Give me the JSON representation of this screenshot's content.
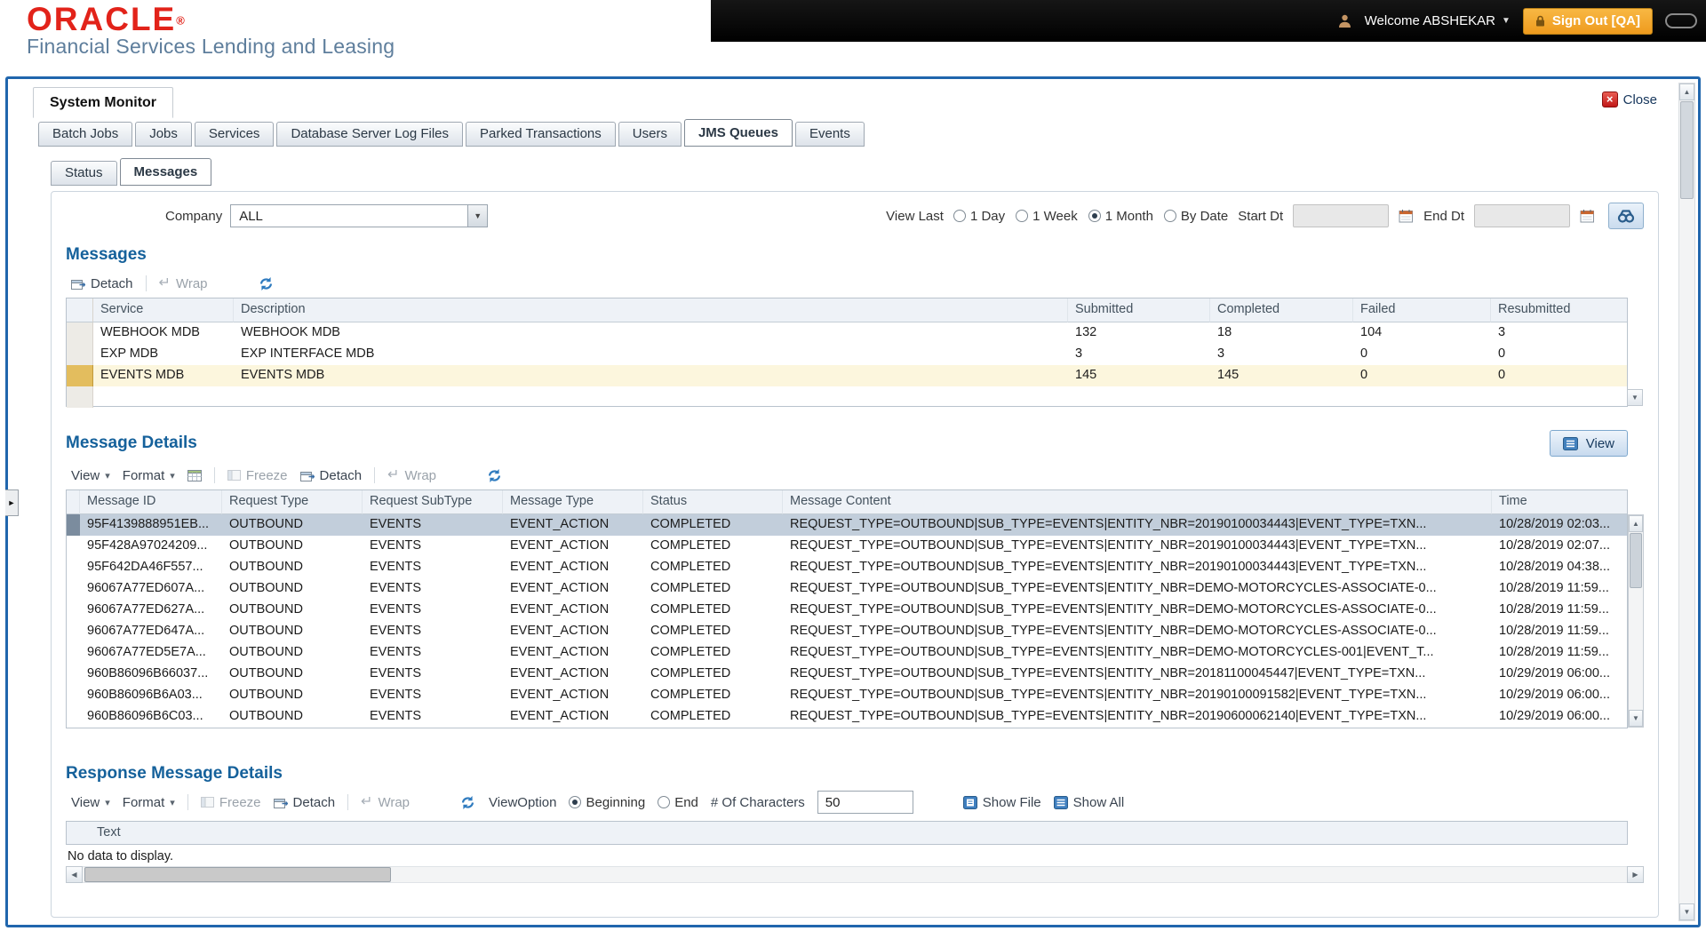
{
  "header": {
    "brand": "ORACLE",
    "registered": "®",
    "subtitle": "Financial Services Lending and Leasing",
    "welcome": "Welcome ABSHEKAR",
    "sign_out": "Sign Out [QA]"
  },
  "window": {
    "title": "System Monitor",
    "close": "Close"
  },
  "tabs": [
    {
      "label": "Batch Jobs"
    },
    {
      "label": "Jobs"
    },
    {
      "label": "Services"
    },
    {
      "label": "Database Server Log Files"
    },
    {
      "label": "Parked Transactions"
    },
    {
      "label": "Users"
    },
    {
      "label": "JMS Queues",
      "active": true
    },
    {
      "label": "Events"
    }
  ],
  "subtabs": [
    {
      "label": "Status"
    },
    {
      "label": "Messages",
      "active": true
    }
  ],
  "filters": {
    "company_label": "Company",
    "company_value": "ALL",
    "view_last_label": "View Last",
    "view_last_options": [
      {
        "label": "1 Day"
      },
      {
        "label": "1 Week"
      },
      {
        "label": "1 Month",
        "selected": true
      },
      {
        "label": "By Date"
      }
    ],
    "start_dt_label": "Start Dt",
    "start_dt_value": "",
    "end_dt_label": "End Dt",
    "end_dt_value": ""
  },
  "messages": {
    "title": "Messages",
    "toolbar": {
      "detach": "Detach",
      "wrap": "Wrap"
    },
    "columns": [
      "Service",
      "Description",
      "Submitted",
      "Completed",
      "Failed",
      "Resubmitted"
    ],
    "rows": [
      {
        "service": "WEBHOOK MDB",
        "description": "WEBHOOK MDB",
        "submitted": "132",
        "completed": "18",
        "failed": "104",
        "resubmitted": "3"
      },
      {
        "service": "EXP MDB",
        "description": "EXP INTERFACE MDB",
        "submitted": "3",
        "completed": "3",
        "failed": "0",
        "resubmitted": "0"
      },
      {
        "service": "EVENTS MDB",
        "description": "EVENTS MDB",
        "submitted": "145",
        "completed": "145",
        "failed": "0",
        "resubmitted": "0",
        "highlight": true
      }
    ]
  },
  "message_details": {
    "title": "Message Details",
    "view_button": "View",
    "toolbar": {
      "view": "View",
      "format": "Format",
      "freeze": "Freeze",
      "detach": "Detach",
      "wrap": "Wrap"
    },
    "columns": [
      "Message ID",
      "Request Type",
      "Request SubType",
      "Message Type",
      "Status",
      "Message Content",
      "Time"
    ],
    "rows": [
      {
        "id": "95F4139888951EB...",
        "request_type": "OUTBOUND",
        "sub_type": "EVENTS",
        "message_type": "EVENT_ACTION",
        "status": "COMPLETED",
        "content": "REQUEST_TYPE=OUTBOUND|SUB_TYPE=EVENTS|ENTITY_NBR=20190100034443|EVENT_TYPE=TXN...",
        "time": "10/28/2019 02:03...",
        "selected": true
      },
      {
        "id": "95F428A97024209...",
        "request_type": "OUTBOUND",
        "sub_type": "EVENTS",
        "message_type": "EVENT_ACTION",
        "status": "COMPLETED",
        "content": "REQUEST_TYPE=OUTBOUND|SUB_TYPE=EVENTS|ENTITY_NBR=20190100034443|EVENT_TYPE=TXN...",
        "time": "10/28/2019 02:07..."
      },
      {
        "id": "95F642DA46F557...",
        "request_type": "OUTBOUND",
        "sub_type": "EVENTS",
        "message_type": "EVENT_ACTION",
        "status": "COMPLETED",
        "content": "REQUEST_TYPE=OUTBOUND|SUB_TYPE=EVENTS|ENTITY_NBR=20190100034443|EVENT_TYPE=TXN...",
        "time": "10/28/2019 04:38..."
      },
      {
        "id": "96067A77ED607A...",
        "request_type": "OUTBOUND",
        "sub_type": "EVENTS",
        "message_type": "EVENT_ACTION",
        "status": "COMPLETED",
        "content": "REQUEST_TYPE=OUTBOUND|SUB_TYPE=EVENTS|ENTITY_NBR=DEMO-MOTORCYCLES-ASSOCIATE-0...",
        "time": "10/28/2019 11:59..."
      },
      {
        "id": "96067A77ED627A...",
        "request_type": "OUTBOUND",
        "sub_type": "EVENTS",
        "message_type": "EVENT_ACTION",
        "status": "COMPLETED",
        "content": "REQUEST_TYPE=OUTBOUND|SUB_TYPE=EVENTS|ENTITY_NBR=DEMO-MOTORCYCLES-ASSOCIATE-0...",
        "time": "10/28/2019 11:59..."
      },
      {
        "id": "96067A77ED647A...",
        "request_type": "OUTBOUND",
        "sub_type": "EVENTS",
        "message_type": "EVENT_ACTION",
        "status": "COMPLETED",
        "content": "REQUEST_TYPE=OUTBOUND|SUB_TYPE=EVENTS|ENTITY_NBR=DEMO-MOTORCYCLES-ASSOCIATE-0...",
        "time": "10/28/2019 11:59..."
      },
      {
        "id": "96067A77ED5E7A...",
        "request_type": "OUTBOUND",
        "sub_type": "EVENTS",
        "message_type": "EVENT_ACTION",
        "status": "COMPLETED",
        "content": "REQUEST_TYPE=OUTBOUND|SUB_TYPE=EVENTS|ENTITY_NBR=DEMO-MOTORCYCLES-001|EVENT_T...",
        "time": "10/28/2019 11:59..."
      },
      {
        "id": "960B86096B66037...",
        "request_type": "OUTBOUND",
        "sub_type": "EVENTS",
        "message_type": "EVENT_ACTION",
        "status": "COMPLETED",
        "content": "REQUEST_TYPE=OUTBOUND|SUB_TYPE=EVENTS|ENTITY_NBR=20181100045447|EVENT_TYPE=TXN...",
        "time": "10/29/2019 06:00..."
      },
      {
        "id": "960B86096B6A03...",
        "request_type": "OUTBOUND",
        "sub_type": "EVENTS",
        "message_type": "EVENT_ACTION",
        "status": "COMPLETED",
        "content": "REQUEST_TYPE=OUTBOUND|SUB_TYPE=EVENTS|ENTITY_NBR=20190100091582|EVENT_TYPE=TXN...",
        "time": "10/29/2019 06:00..."
      },
      {
        "id": "960B86096B6C03...",
        "request_type": "OUTBOUND",
        "sub_type": "EVENTS",
        "message_type": "EVENT_ACTION",
        "status": "COMPLETED",
        "content": "REQUEST_TYPE=OUTBOUND|SUB_TYPE=EVENTS|ENTITY_NBR=20190600062140|EVENT_TYPE=TXN...",
        "time": "10/29/2019 06:00..."
      }
    ]
  },
  "response_details": {
    "title": "Response Message Details",
    "toolbar": {
      "view": "View",
      "format": "Format",
      "freeze": "Freeze",
      "detach": "Detach",
      "wrap": "Wrap",
      "view_option_label": "ViewOption",
      "view_options": [
        {
          "label": "Beginning",
          "selected": true
        },
        {
          "label": "End"
        }
      ],
      "chars_label": "# Of Characters",
      "chars_value": "50",
      "show_file": "Show File",
      "show_all": "Show All"
    },
    "columns": [
      "Text"
    ],
    "empty_text": "No data to display."
  },
  "icons": {
    "welcome_caret": "▼",
    "menu_caret": "▾",
    "select_arrow": "▼",
    "wrap": "↵",
    "close_x": "×",
    "scroll_up": "▲",
    "scroll_down": "▼",
    "scroll_left": "◀",
    "scroll_right": "▶",
    "expander": "►"
  }
}
